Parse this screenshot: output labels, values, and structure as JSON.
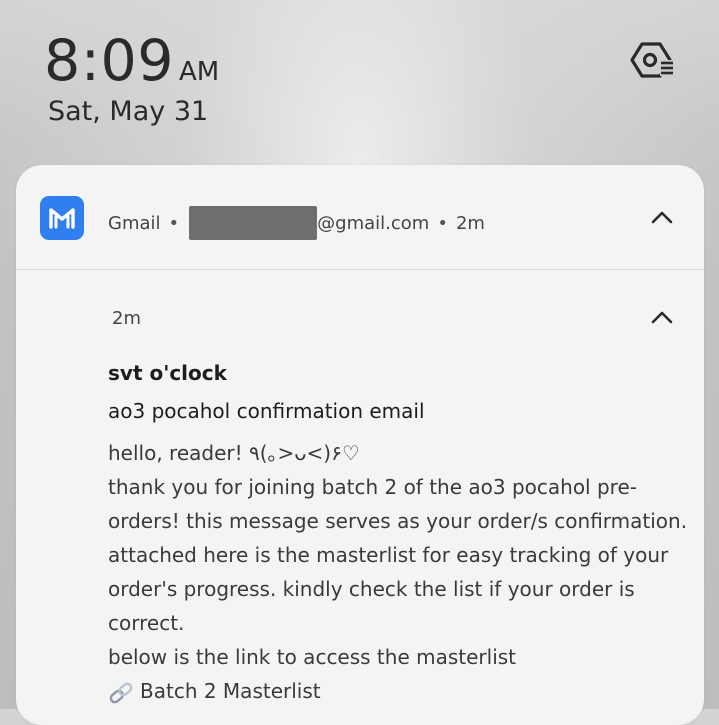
{
  "lockscreen": {
    "time": "8:09",
    "ampm": "AM",
    "date": "Sat, May 31"
  },
  "icons": {
    "settings": "settings-gear-icon",
    "app": "gmail-m-icon",
    "collapse": "chevron-up-icon",
    "link": "link-icon"
  },
  "notification": {
    "app_name": "Gmail",
    "separator": "•",
    "account_suffix": "@gmail.com",
    "age": "2m",
    "message": {
      "time": "2m",
      "sender": "svt o'clock",
      "subject": "ao3 pocahol confirmation email",
      "body_lines": [
        "hello, reader! ٩(｡>ᴗ<)۶♡",
        "thank you for joining batch 2 of the ao3 pocahol pre-",
        "orders! this message serves as your order/s confirmation.",
        "attached here is the masterlist for easy tracking of your",
        "order's progress. kindly check the list if your order is",
        "correct.",
        "below is the link to access the masterlist"
      ],
      "link_text": "Batch 2 Masterlist"
    }
  },
  "colors": {
    "app_icon_bg": "#2f7ff0",
    "card_bg": "#f4f4f4"
  }
}
